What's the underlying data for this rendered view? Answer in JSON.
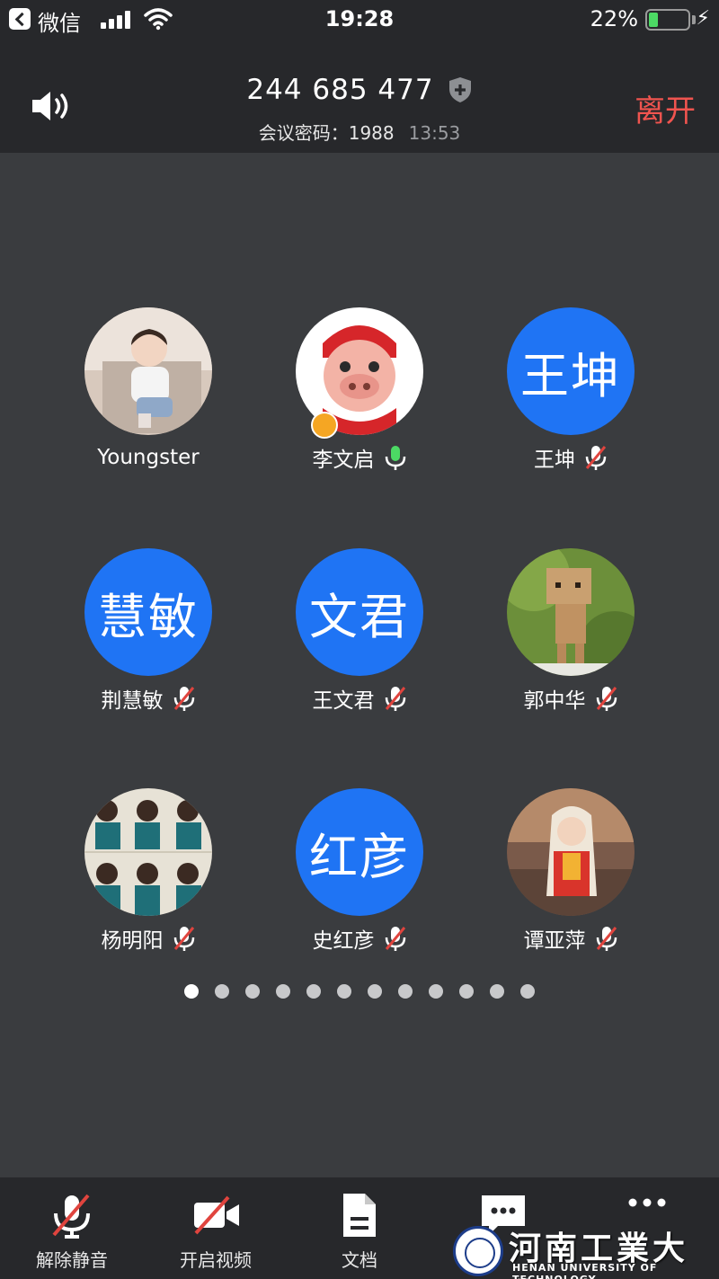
{
  "status_bar": {
    "back_app": "微信",
    "time": "19:28",
    "battery_pct": "22%",
    "battery_level": 0.22
  },
  "header": {
    "meeting_id": "244 685 477",
    "password_label": "会议密码：1988",
    "duration": "13:53",
    "leave_label": "离开"
  },
  "participants": [
    {
      "name": "Youngster",
      "avatar_type": "photo",
      "mic": "none"
    },
    {
      "name": "李文启",
      "avatar_type": "photo",
      "mic": "on",
      "host": true
    },
    {
      "name": "王坤",
      "avatar_type": "text",
      "avatar_text": "王坤",
      "mic": "muted"
    },
    {
      "name": "荆慧敏",
      "avatar_type": "text",
      "avatar_text": "慧敏",
      "mic": "muted"
    },
    {
      "name": "王文君",
      "avatar_type": "text",
      "avatar_text": "文君",
      "mic": "muted"
    },
    {
      "name": "郭中华",
      "avatar_type": "photo",
      "mic": "muted"
    },
    {
      "name": "杨明阳",
      "avatar_type": "photo",
      "mic": "muted"
    },
    {
      "name": "史红彦",
      "avatar_type": "text",
      "avatar_text": "红彦",
      "mic": "muted"
    },
    {
      "name": "谭亚萍",
      "avatar_type": "photo",
      "mic": "muted"
    }
  ],
  "pagination": {
    "total": 12,
    "current": 1
  },
  "toolbar": {
    "unmute_label": "解除静音",
    "video_label": "开启视频",
    "docs_label": "文档"
  },
  "watermark": {
    "title": "河南工業大學",
    "subtitle": "HENAN UNIVERSITY OF TECHNOLOGY"
  },
  "colors": {
    "background": "#3a3c3f",
    "bar": "#27282b",
    "avatar_blue": "#1f74f4",
    "leave_red": "#f0544f",
    "mic_on_green": "#4cd964",
    "muted_red": "#e0443e"
  }
}
